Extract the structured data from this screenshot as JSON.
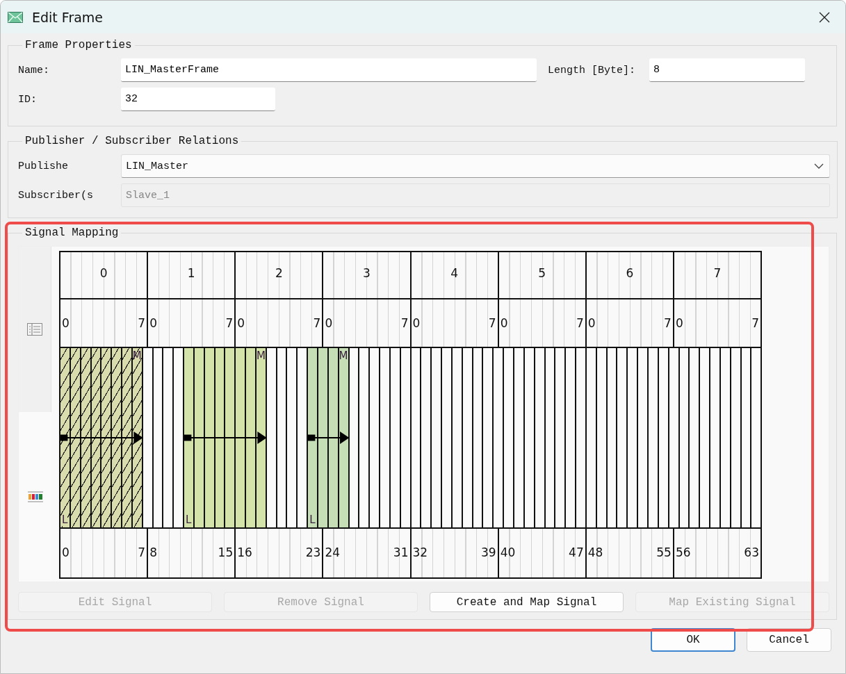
{
  "window": {
    "title": "Edit Frame"
  },
  "frame_properties": {
    "title": "Frame Properties",
    "name_label": "Name:",
    "name_value": "LIN_MasterFrame",
    "length_label": "Length [Byte]:",
    "length_value": "8",
    "id_label": "ID:",
    "id_value": "32"
  },
  "relations": {
    "title": "Publisher / Subscriber Relations",
    "publisher_label": "Publishe",
    "publisher_value": "LIN_Master",
    "subscriber_label": "Subscriber(s",
    "subscriber_value": "Slave_1",
    "subscriber_disabled": true
  },
  "signal_mapping": {
    "title": "Signal Mapping",
    "view_tabs": [
      {
        "kind": "list",
        "selected": false
      },
      {
        "kind": "color-bars",
        "selected": true
      }
    ],
    "bytes": [
      {
        "byte": "0",
        "bit_lo": "0",
        "bit_hi": "7",
        "abs_lo": "0",
        "abs_hi": "7"
      },
      {
        "byte": "1",
        "bit_lo": "0",
        "bit_hi": "7",
        "abs_lo": "8",
        "abs_hi": "15"
      },
      {
        "byte": "2",
        "bit_lo": "0",
        "bit_hi": "7",
        "abs_lo": "16",
        "abs_hi": "23"
      },
      {
        "byte": "3",
        "bit_lo": "0",
        "bit_hi": "7",
        "abs_lo": "24",
        "abs_hi": "31"
      },
      {
        "byte": "4",
        "bit_lo": "0",
        "bit_hi": "7",
        "abs_lo": "32",
        "abs_hi": "39"
      },
      {
        "byte": "5",
        "bit_lo": "0",
        "bit_hi": "7",
        "abs_lo": "40",
        "abs_hi": "47"
      },
      {
        "byte": "6",
        "bit_lo": "0",
        "bit_hi": "7",
        "abs_lo": "48",
        "abs_hi": "55"
      },
      {
        "byte": "7",
        "bit_lo": "0",
        "bit_hi": "7",
        "abs_lo": "56",
        "abs_hi": "63"
      }
    ],
    "bit_cells": [
      {
        "kind": "signal",
        "color": "#d9ddae",
        "hatched": true,
        "lsb_label": "L"
      },
      {
        "kind": "signal",
        "color": "#d9ddae",
        "hatched": true
      },
      {
        "kind": "signal",
        "color": "#d9ddae",
        "hatched": true
      },
      {
        "kind": "signal",
        "color": "#d9ddae",
        "hatched": true
      },
      {
        "kind": "signal",
        "color": "#d9ddae",
        "hatched": true
      },
      {
        "kind": "signal",
        "color": "#d9ddae",
        "hatched": true
      },
      {
        "kind": "signal",
        "color": "#d9ddae",
        "hatched": true
      },
      {
        "kind": "signal",
        "color": "#d9ddae",
        "hatched": true,
        "msb_label": "M"
      },
      {
        "kind": "free"
      },
      {
        "kind": "free"
      },
      {
        "kind": "free"
      },
      {
        "kind": "free"
      },
      {
        "kind": "signal",
        "color": "#d4e3a9",
        "hatched": false,
        "lsb_label": "L"
      },
      {
        "kind": "signal",
        "color": "#d4e3a9",
        "hatched": false
      },
      {
        "kind": "signal",
        "color": "#d4e3a9",
        "hatched": false
      },
      {
        "kind": "signal",
        "color": "#d4e3a9",
        "hatched": false
      },
      {
        "kind": "signal",
        "color": "#d4e3a9",
        "hatched": false
      },
      {
        "kind": "signal",
        "color": "#d4e3a9",
        "hatched": false
      },
      {
        "kind": "signal",
        "color": "#d4e3a9",
        "hatched": false
      },
      {
        "kind": "signal",
        "color": "#d4e3a9",
        "hatched": false,
        "msb_label": "M"
      },
      {
        "kind": "free"
      },
      {
        "kind": "free"
      },
      {
        "kind": "free"
      },
      {
        "kind": "free"
      },
      {
        "kind": "signal",
        "color": "#c6deb6",
        "hatched": false,
        "lsb_label": "L"
      },
      {
        "kind": "signal",
        "color": "#c6deb6",
        "hatched": false
      },
      {
        "kind": "signal",
        "color": "#c6deb6",
        "hatched": false
      },
      {
        "kind": "signal",
        "color": "#c6deb6",
        "hatched": false,
        "msb_label": "M"
      },
      {
        "kind": "free"
      },
      {
        "kind": "free"
      },
      {
        "kind": "free"
      },
      {
        "kind": "free"
      },
      {
        "kind": "free"
      },
      {
        "kind": "free"
      },
      {
        "kind": "free"
      },
      {
        "kind": "free"
      },
      {
        "kind": "free"
      },
      {
        "kind": "free"
      },
      {
        "kind": "free"
      },
      {
        "kind": "free"
      },
      {
        "kind": "free"
      },
      {
        "kind": "free"
      },
      {
        "kind": "free"
      },
      {
        "kind": "free"
      },
      {
        "kind": "free"
      },
      {
        "kind": "free"
      },
      {
        "kind": "free"
      },
      {
        "kind": "free"
      },
      {
        "kind": "free"
      },
      {
        "kind": "free"
      },
      {
        "kind": "free"
      },
      {
        "kind": "free"
      },
      {
        "kind": "free"
      },
      {
        "kind": "free"
      },
      {
        "kind": "free"
      },
      {
        "kind": "free"
      },
      {
        "kind": "free"
      },
      {
        "kind": "free"
      },
      {
        "kind": "free"
      },
      {
        "kind": "free"
      },
      {
        "kind": "free"
      },
      {
        "kind": "free"
      },
      {
        "kind": "free"
      },
      {
        "kind": "free"
      },
      {
        "kind": "free"
      },
      {
        "kind": "free"
      },
      {
        "kind": "free"
      },
      {
        "kind": "free"
      }
    ],
    "buttons": [
      {
        "label": "Edit Signal",
        "disabled": true
      },
      {
        "label": "Remove Signal",
        "disabled": true
      },
      {
        "label": "Create and Map Signal",
        "disabled": false
      },
      {
        "label": "Map Existing Signal",
        "disabled": true
      }
    ]
  },
  "dialog_buttons": [
    {
      "label": "OK",
      "default": true
    },
    {
      "label": "Cancel",
      "default": false
    }
  ]
}
